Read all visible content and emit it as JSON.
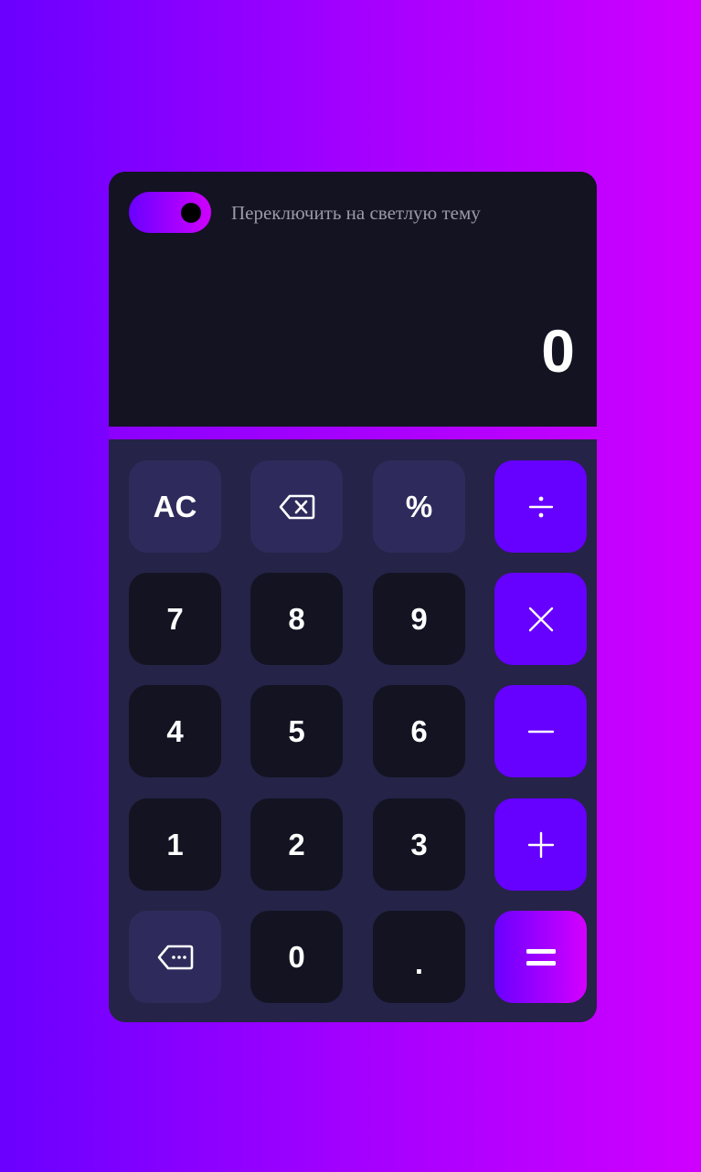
{
  "theme_toggle": {
    "label": "Переключить на светлую тему",
    "state": "dark"
  },
  "display": {
    "value": "0"
  },
  "keys": {
    "ac": "AC",
    "percent": "%",
    "seven": "7",
    "eight": "8",
    "nine": "9",
    "four": "4",
    "five": "5",
    "six": "6",
    "one": "1",
    "two": "2",
    "three": "3",
    "zero": "0",
    "dot": "."
  },
  "icons": {
    "backspace": "backspace-icon",
    "divide": "divide-icon",
    "multiply": "multiply-icon",
    "minus": "minus-icon",
    "plus": "plus-icon",
    "more": "more-options-icon",
    "equals": "equals-icon"
  },
  "colors": {
    "background_start": "#6a00ff",
    "background_end": "#cf00ff",
    "display_bg": "#131322",
    "keypad_bg": "#252347",
    "function_key": "#2e2b5c",
    "number_key": "#131322",
    "operator_key": "#6600ff",
    "label_text": "#9a9aa8"
  }
}
